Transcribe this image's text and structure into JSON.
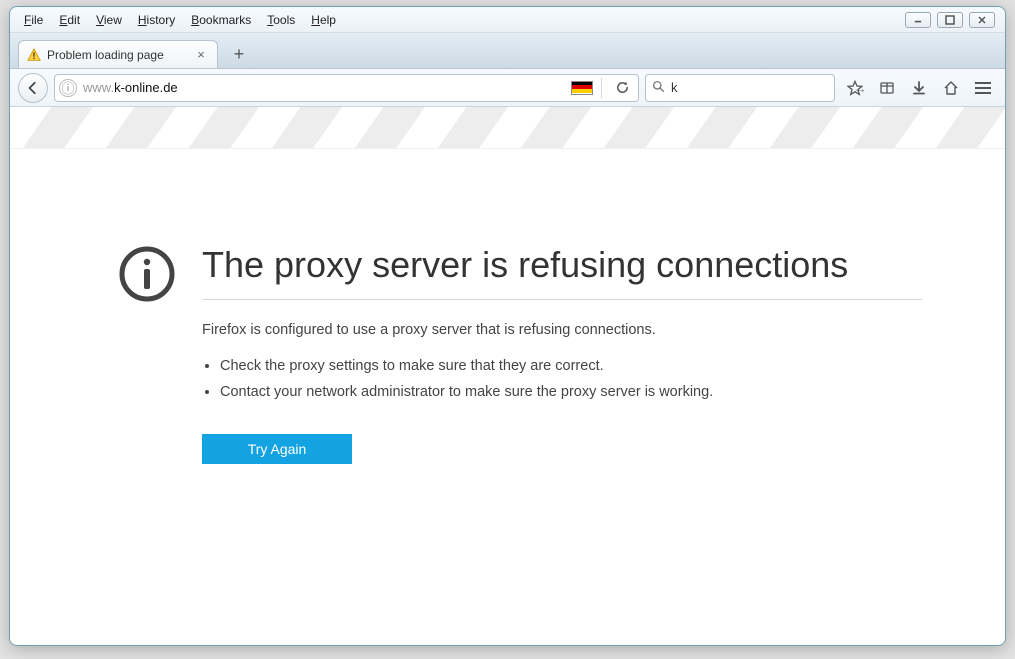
{
  "menu": {
    "items": [
      "File",
      "Edit",
      "View",
      "History",
      "Bookmarks",
      "Tools",
      "Help"
    ]
  },
  "windowControls": {
    "min": "—",
    "max": "☐",
    "close": "✕"
  },
  "tab": {
    "title": "Problem loading page"
  },
  "url": {
    "prefix": "www.",
    "domain": "k-online.de"
  },
  "search": {
    "value": "k"
  },
  "error": {
    "title": "The proxy server is refusing connections",
    "description": "Firefox is configured to use a proxy server that is refusing connections.",
    "bullets": [
      "Check the proxy settings to make sure that they are correct.",
      "Contact your network administrator to make sure the proxy server is working."
    ],
    "tryAgain": "Try Again"
  }
}
